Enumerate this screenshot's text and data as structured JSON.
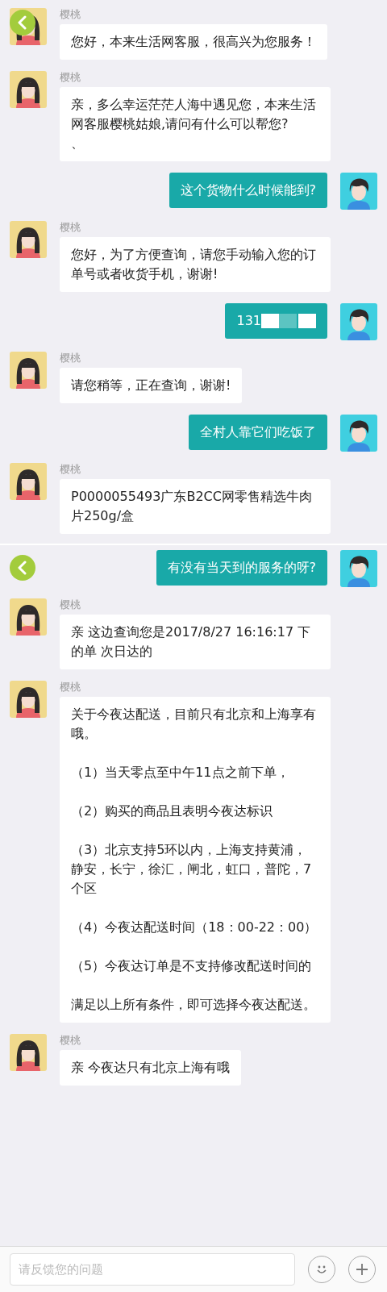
{
  "panels": [
    {
      "back_button": true,
      "messages": [
        {
          "kind": "agent",
          "name": "樱桃",
          "text": "您好，本来生活网客服，很高兴为您服务！"
        },
        {
          "kind": "agent",
          "name": "樱桃",
          "text": "亲，多么幸运茫茫人海中遇见您，本来生活网客服樱桃姑娘,请问有什么可以帮您?\n、"
        },
        {
          "kind": "user",
          "text": "这个货物什么时候能到?"
        },
        {
          "kind": "agent",
          "name": "樱桃",
          "text": "您好，为了方便查询，请您手动输入您的订单号或者收货手机，谢谢!"
        },
        {
          "kind": "user",
          "text": "131",
          "redacted": true
        },
        {
          "kind": "agent",
          "name": "樱桃",
          "text": "请您稍等，正在查询，谢谢!"
        },
        {
          "kind": "user",
          "text": "全村人靠它们吃饭了"
        },
        {
          "kind": "agent",
          "name": "樱桃",
          "text": "P0000055493广东B2CC网零售精选牛肉片250g/盒"
        }
      ]
    },
    {
      "back_button": true,
      "messages": [
        {
          "kind": "user",
          "text": "有没有当天到的服务的呀?"
        },
        {
          "kind": "agent",
          "name": "樱桃",
          "text": "亲 这边查询您是2017/8/27 16:16:17 下的单 次日达的"
        },
        {
          "kind": "agent",
          "name": "樱桃",
          "paragraphs": [
            "关于今夜达配送，目前只有北京和上海享有哦。",
            "（1）当天零点至中午11点之前下单，",
            "（2）购买的商品且表明今夜达标识",
            "（3）北京支持5环以内，上海支持黄浦，静安，长宁，徐汇，闸北，虹口，普陀，7个区",
            "（4）今夜达配送时间（18：00-22：00）",
            "（5）今夜达订单是不支持修改配送时间的",
            "满足以上所有条件，即可选择今夜达配送。"
          ]
        },
        {
          "kind": "agent",
          "name": "樱桃",
          "text": "亲 今夜达只有北京上海有哦"
        }
      ],
      "input": {
        "placeholder": "请反馈您的问题"
      }
    }
  ]
}
